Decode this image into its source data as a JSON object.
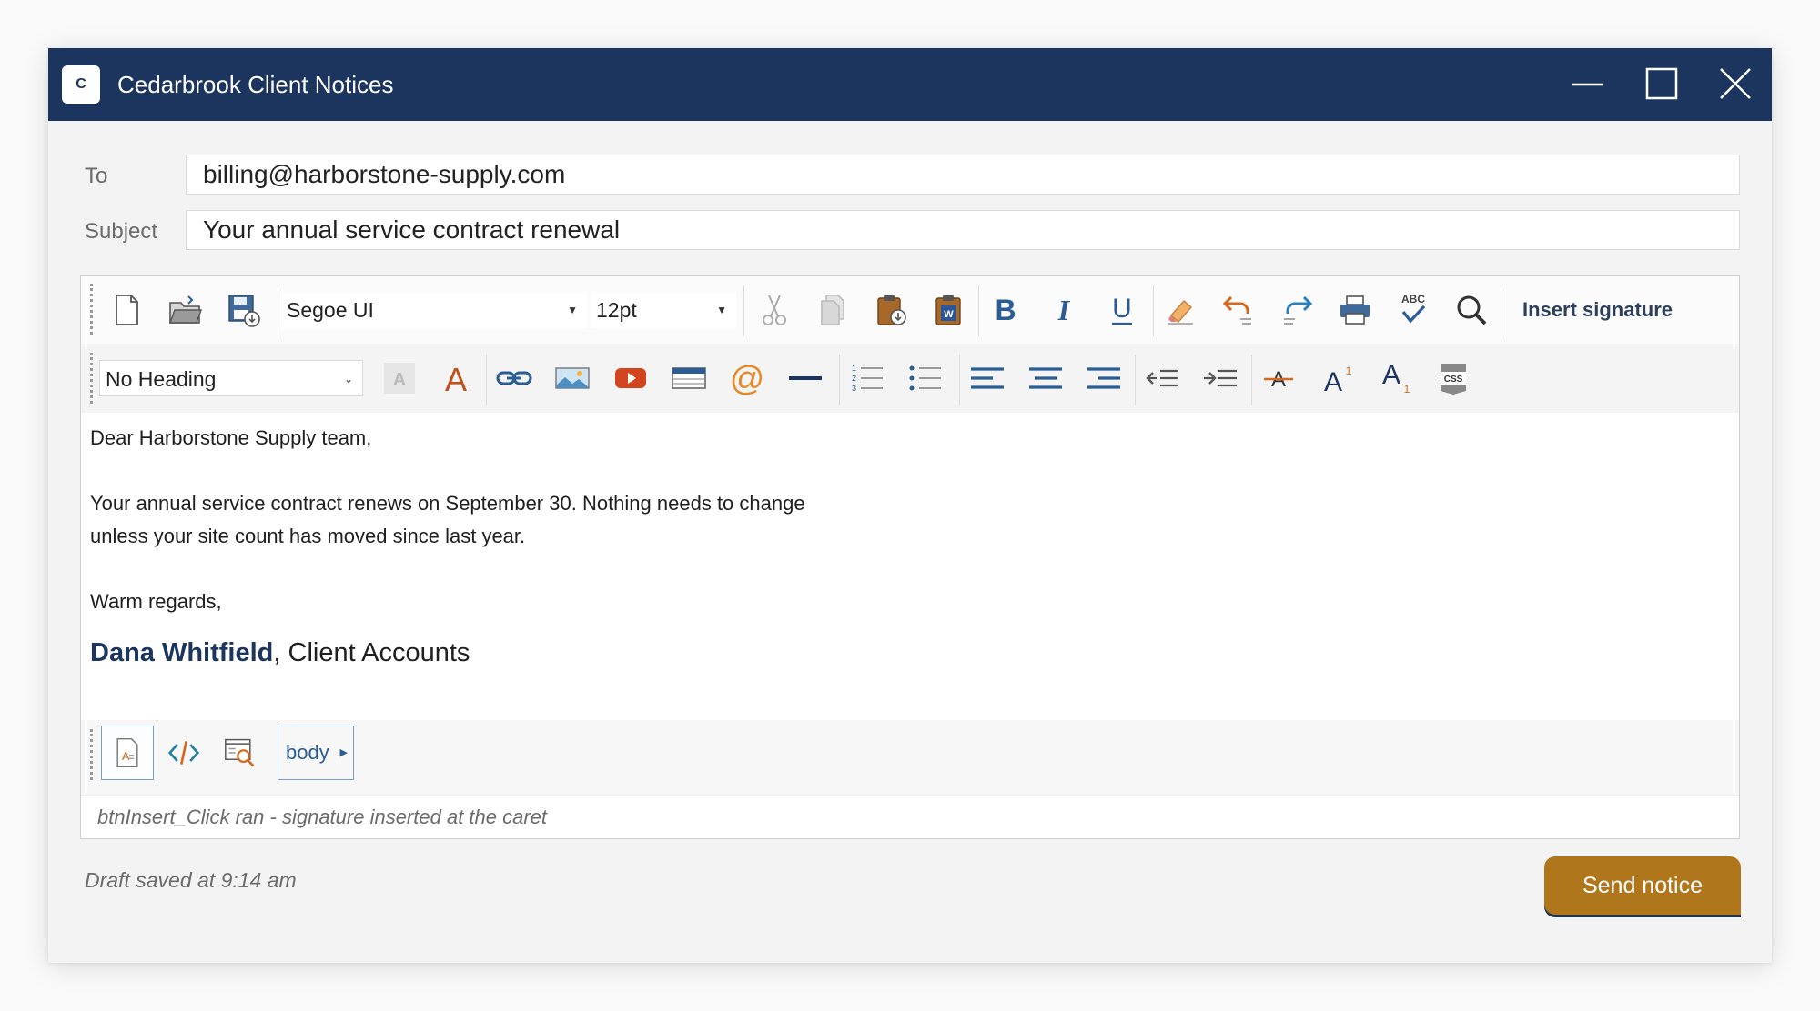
{
  "window": {
    "app_initial": "C",
    "title": "Cedarbrook Client Notices"
  },
  "compose": {
    "to_label": "To",
    "to_value": "billing@harborstone-supply.com",
    "subject_label": "Subject",
    "subject_value": "Your annual service contract renewal"
  },
  "toolbar": {
    "font_family": "Segoe UI",
    "font_size": "12pt",
    "heading": "No Heading",
    "insert_signature_label": "Insert signature",
    "spellcheck_label": "ABC",
    "css_label": "CSS",
    "icons": [
      "new-document-icon",
      "open-folder-icon",
      "save-icon",
      "cut-icon",
      "copy-icon",
      "paste-icon",
      "paste-from-word-icon",
      "bold-icon",
      "italic-icon",
      "underline-icon",
      "eraser-icon",
      "undo-icon",
      "redo-icon",
      "print-icon",
      "spellcheck-icon",
      "find-icon",
      "background-color-icon",
      "font-color-icon",
      "link-icon",
      "image-icon",
      "video-icon",
      "table-icon",
      "email-link-icon",
      "horizontal-rule-icon",
      "numbered-list-icon",
      "bullet-list-icon",
      "align-left-icon",
      "align-center-icon",
      "align-right-icon",
      "outdent-icon",
      "indent-icon",
      "strikethrough-icon",
      "superscript-icon",
      "subscript-icon",
      "css-icon"
    ]
  },
  "body": {
    "greeting": "Dear Harborstone Supply team,",
    "line1": "Your annual service contract renews on September 30. Nothing needs to change",
    "line2": "unless your site count has moved since last year.",
    "closing": "Warm regards,",
    "signature_name": "Dana Whitfield",
    "signature_suffix": ", Client Accounts"
  },
  "bottom_bar": {
    "breadcrumb": "body",
    "modes": [
      "design-mode-icon",
      "code-view-icon",
      "preview-icon"
    ]
  },
  "status": {
    "editor_message": "btnInsert_Click ran - signature inserted at the caret",
    "draft_status": "Draft saved at 9:14 am",
    "send_label": "Send notice"
  },
  "colors": {
    "titlebar": "#1c355e",
    "send_button": "#b0761c",
    "accent_blue": "#2a5d96",
    "accent_orange": "#d2691e"
  }
}
